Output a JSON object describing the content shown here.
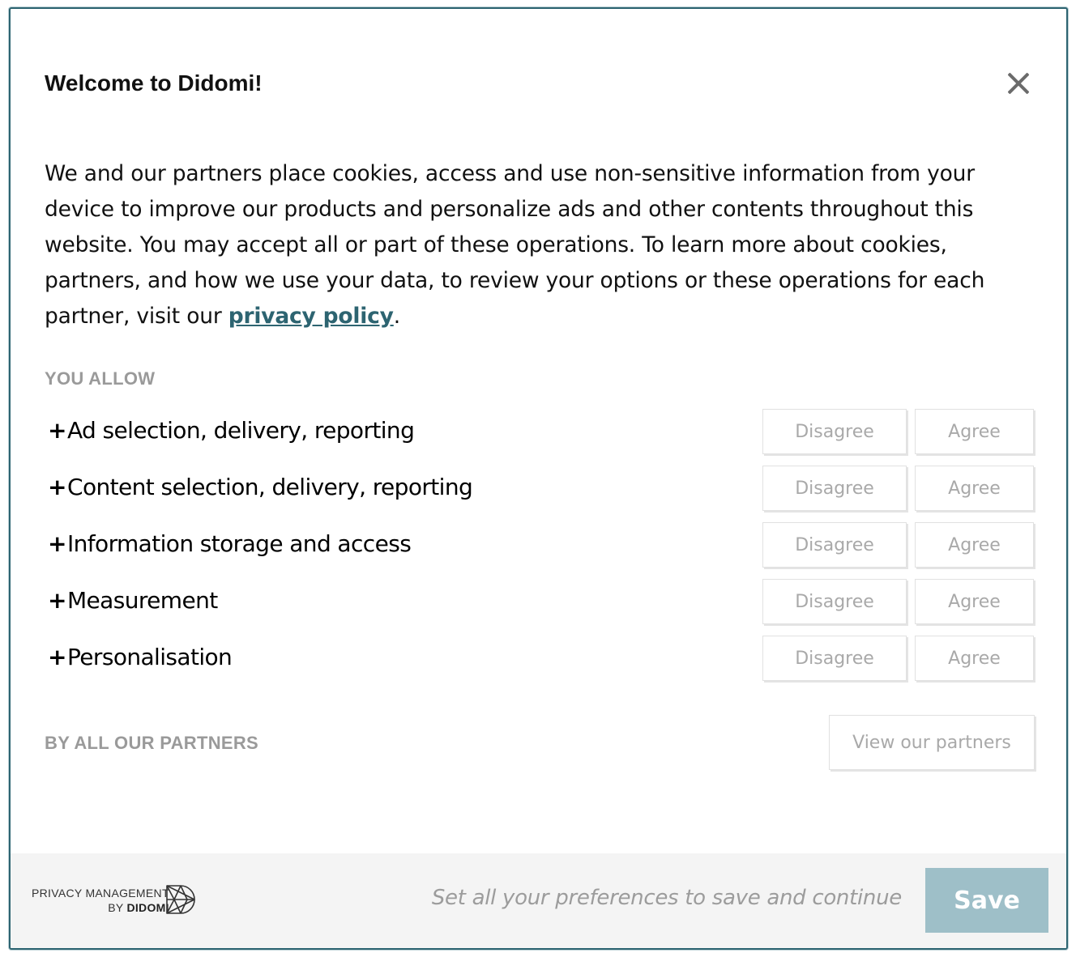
{
  "dialog": {
    "title": "Welcome to Didomi!",
    "intro_text": "We and our partners place cookies, access and use non-sensitive information from your device to improve our products and personalize ads and other contents throughout this website. You may accept all or part of these operations. To learn more about cookies, partners, and how we use your data, to review your options or these operations for each partner, visit our ",
    "privacy_link": "privacy policy",
    "intro_end": "."
  },
  "you_allow_label": "YOU ALLOW",
  "purposes": [
    {
      "label": "Ad selection, delivery, reporting",
      "disagree": "Disagree",
      "agree": "Agree"
    },
    {
      "label": "Content selection, delivery, reporting",
      "disagree": "Disagree",
      "agree": "Agree"
    },
    {
      "label": "Information storage and access",
      "disagree": "Disagree",
      "agree": "Agree"
    },
    {
      "label": "Measurement",
      "disagree": "Disagree",
      "agree": "Agree"
    },
    {
      "label": "Personalisation",
      "disagree": "Disagree",
      "agree": "Agree"
    }
  ],
  "expand_symbol": "+",
  "partners": {
    "label": "BY ALL OUR PARTNERS",
    "button": "View our partners"
  },
  "footer": {
    "brand_line1": "PRIVACY MANAGEMENT",
    "brand_line2_prefix": "BY ",
    "brand_line2_name": "DIDOMI",
    "hint": "Set all your preferences to save and continue",
    "save": "Save"
  },
  "colors": {
    "accent": "#2d6471",
    "save_bg": "#9ebfc8",
    "muted": "#a9a9a9"
  },
  "icons": {
    "close": "close-icon",
    "brand": "didomi-logo-icon"
  }
}
